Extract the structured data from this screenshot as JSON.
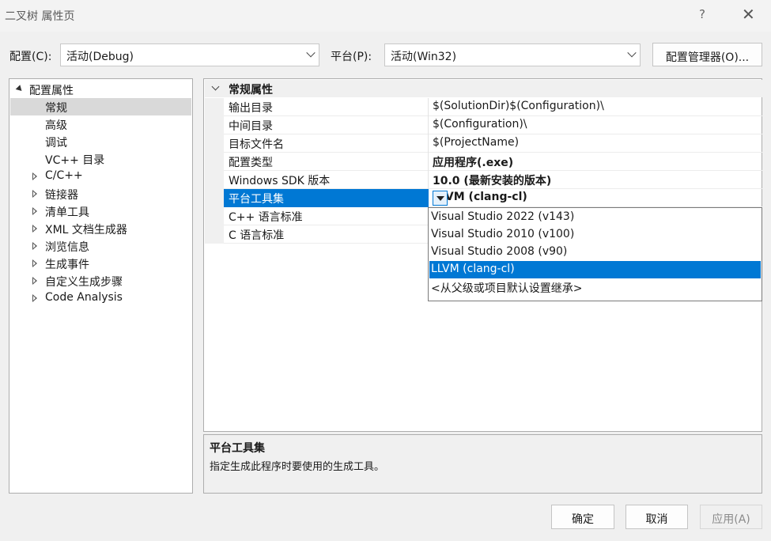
{
  "window": {
    "title": "二叉树 属性页",
    "help": "?",
    "close": "✕"
  },
  "config": {
    "label": "配置(C):",
    "value": "活动(Debug)"
  },
  "platform": {
    "label": "平台(P):",
    "value": "活动(Win32)"
  },
  "config_manager_label": "配置管理器(O)...",
  "tree": [
    {
      "label": "配置属性",
      "expander": "expanded"
    },
    {
      "label": "常规",
      "expander": "none",
      "selected": true
    },
    {
      "label": "高级",
      "expander": "none"
    },
    {
      "label": "调试",
      "expander": "none"
    },
    {
      "label": "VC++ 目录",
      "expander": "none"
    },
    {
      "label": "C/C++",
      "expander": "collapsed"
    },
    {
      "label": "链接器",
      "expander": "collapsed"
    },
    {
      "label": "清单工具",
      "expander": "collapsed"
    },
    {
      "label": "XML 文档生成器",
      "expander": "collapsed"
    },
    {
      "label": "浏览信息",
      "expander": "collapsed"
    },
    {
      "label": "生成事件",
      "expander": "collapsed"
    },
    {
      "label": "自定义生成步骤",
      "expander": "collapsed"
    },
    {
      "label": "Code Analysis",
      "expander": "collapsed"
    }
  ],
  "grid": {
    "category": "常规属性",
    "rows": [
      {
        "name": "输出目录",
        "value": "$(SolutionDir)$(Configuration)\\"
      },
      {
        "name": "中间目录",
        "value": "$(Configuration)\\"
      },
      {
        "name": "目标文件名",
        "value": "$(ProjectName)"
      },
      {
        "name": "配置类型",
        "value": "应用程序(.exe)",
        "bold": true
      },
      {
        "name": "Windows SDK 版本",
        "value": "10.0 (最新安装的版本)",
        "bold": true
      },
      {
        "name": "平台工具集",
        "value": "LLVM (clang-cl)",
        "bold": true,
        "selected": true
      },
      {
        "name": "C++ 语言标准",
        "value": ""
      },
      {
        "name": "C 语言标准",
        "value": ""
      }
    ]
  },
  "dropdown_options": [
    {
      "label": "Visual Studio 2022 (v143)"
    },
    {
      "label": "Visual Studio 2010 (v100)"
    },
    {
      "label": "Visual Studio 2008 (v90)"
    },
    {
      "label": "LLVM (clang-cl)",
      "selected": true
    },
    {
      "label": "<从父级或项目默认设置继承>"
    }
  ],
  "description": {
    "title": "平台工具集",
    "text": "指定生成此程序时要使用的生成工具。"
  },
  "buttons": {
    "ok": "确定",
    "cancel": "取消",
    "apply": "应用(A)"
  },
  "colors": {
    "accent": "#0078d4",
    "tree_selection": "#d9d9d9",
    "dialog_bg": "#f0f0f0"
  }
}
